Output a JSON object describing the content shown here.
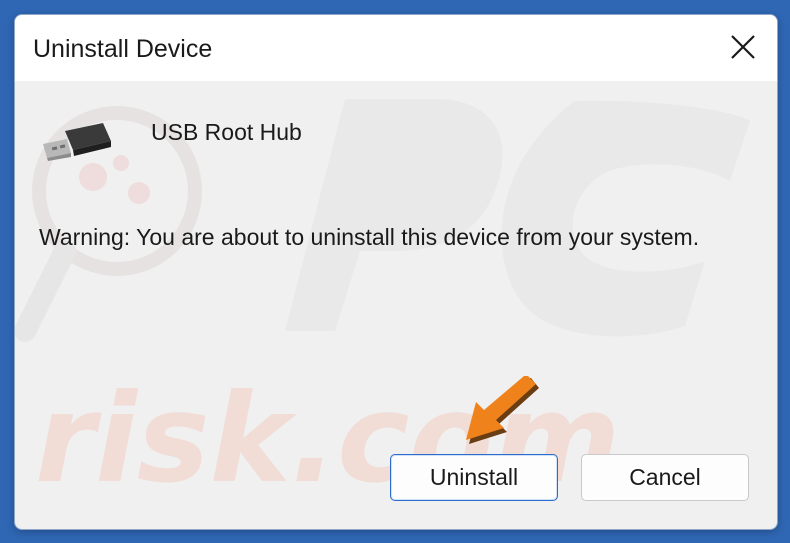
{
  "dialog": {
    "title": "Uninstall Device",
    "close_icon": "close-icon",
    "device_icon": "usb-connector-icon",
    "device_name": "USB Root Hub",
    "warning": "Warning: You are about to uninstall this device from your system.",
    "uninstall_label": "Uninstall",
    "cancel_label": "Cancel"
  },
  "overlay": {
    "pointer_icon": "orange-arrow-icon",
    "watermark_text": "PC risk.com",
    "arrow_color": "#f0821c"
  },
  "colors": {
    "desktop": "#2f67b4",
    "dialog_body": "#f0f0f0",
    "titlebar": "#ffffff",
    "primary_button_border": "#2b6ccf"
  }
}
